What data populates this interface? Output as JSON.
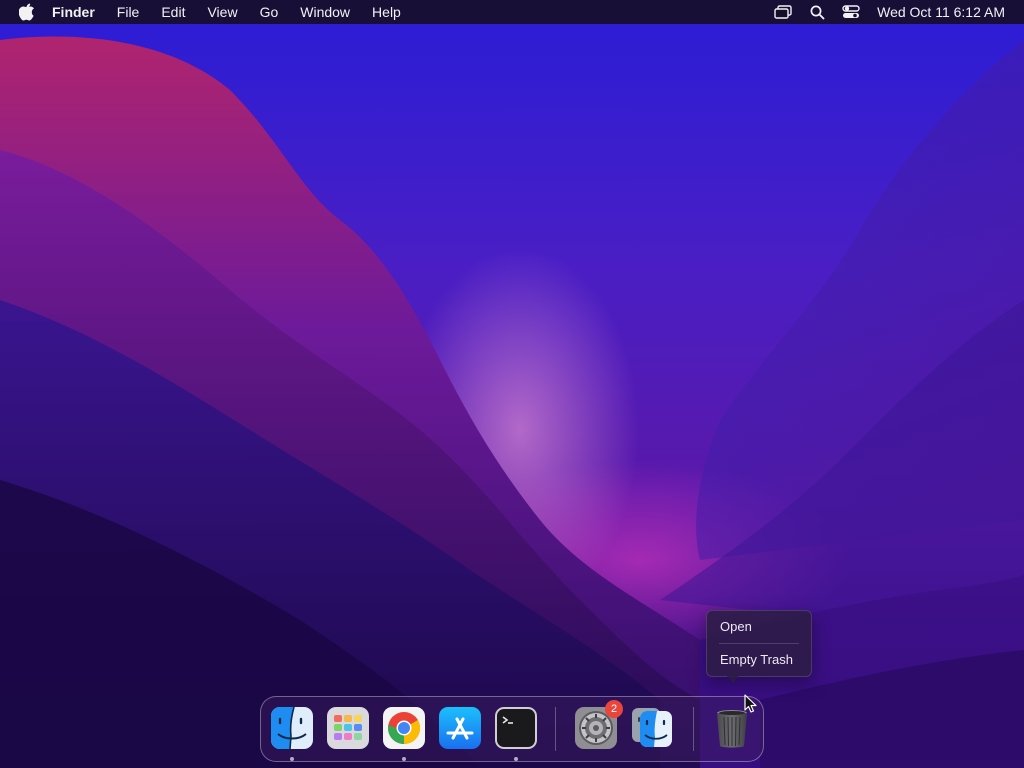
{
  "menubar": {
    "apple_icon": "apple-logo-icon",
    "app_name": "Finder",
    "menus": [
      "File",
      "Edit",
      "View",
      "Go",
      "Window",
      "Help"
    ],
    "status_icons": [
      "screen-mirroring-icon",
      "spotlight-search-icon",
      "control-center-icon"
    ],
    "clock": "Wed Oct 11  6:12 AM"
  },
  "context_menu": {
    "items": [
      "Open",
      "Empty Trash"
    ]
  },
  "dock": {
    "apps": [
      {
        "name": "Finder",
        "icon": "finder-icon",
        "running": true
      },
      {
        "name": "Launchpad",
        "icon": "launchpad-icon",
        "running": false
      },
      {
        "name": "Google Chrome",
        "icon": "chrome-icon",
        "running": true
      },
      {
        "name": "App Store",
        "icon": "app-store-icon",
        "running": false
      },
      {
        "name": "Terminal",
        "icon": "terminal-icon",
        "running": true
      },
      {
        "name": "System Settings",
        "icon": "system-settings-icon",
        "running": false,
        "badge": "2"
      },
      {
        "name": "Migration Assistant",
        "icon": "migration-assistant-icon",
        "running": false
      },
      {
        "name": "Trash",
        "icon": "trash-icon",
        "running": false
      }
    ]
  },
  "colors": {
    "menubar_bg": "#160e28",
    "badge_red": "#e8453c",
    "finder_blue": "#1e8cf0",
    "chrome_red": "#ea4335",
    "chrome_green": "#34a853",
    "chrome_yellow": "#fbbc05",
    "chrome_blue": "#4285f4"
  }
}
